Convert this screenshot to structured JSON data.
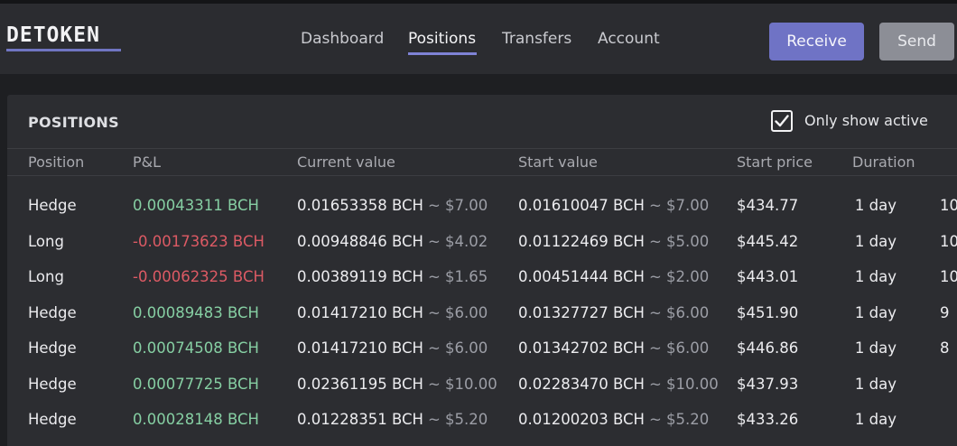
{
  "app": {
    "logo": "DETOKEN"
  },
  "nav": {
    "items": [
      {
        "label": "Dashboard",
        "active": false
      },
      {
        "label": "Positions",
        "active": true
      },
      {
        "label": "Transfers",
        "active": false
      },
      {
        "label": "Account",
        "active": false
      }
    ]
  },
  "actions": {
    "receive_label": "Receive",
    "send_label": "Send"
  },
  "colors": {
    "accent": "#6f73c5",
    "positive": "#86cfa3",
    "negative": "#dc5a64",
    "background": "#1e1f22",
    "panel": "#2c2d31"
  },
  "panel": {
    "title": "POSITIONS",
    "only_active": {
      "label": "Only show active",
      "checked": true
    },
    "columns": [
      "Position",
      "P&L",
      "Current value",
      "Start value",
      "Start price",
      "Duration"
    ],
    "rows": [
      {
        "position": "Hedge",
        "pnl": "0.00043311 BCH",
        "pnl_sign": "pos",
        "current_bch": "0.01653358 BCH",
        "current_usd": "~ $7.00",
        "start_bch": "0.01610047 BCH",
        "start_usd": "~ $7.00",
        "start_price": "$434.77",
        "duration": "1 day",
        "extra": "10"
      },
      {
        "position": "Long",
        "pnl": "-0.00173623 BCH",
        "pnl_sign": "neg",
        "current_bch": "0.00948846 BCH",
        "current_usd": "~ $4.02",
        "start_bch": "0.01122469 BCH",
        "start_usd": "~ $5.00",
        "start_price": "$445.42",
        "duration": "1 day",
        "extra": "10"
      },
      {
        "position": "Long",
        "pnl": "-0.00062325 BCH",
        "pnl_sign": "neg",
        "current_bch": "0.00389119 BCH",
        "current_usd": "~ $1.65",
        "start_bch": "0.00451444 BCH",
        "start_usd": "~ $2.00",
        "start_price": "$443.01",
        "duration": "1 day",
        "extra": "10"
      },
      {
        "position": "Hedge",
        "pnl": "0.00089483 BCH",
        "pnl_sign": "pos",
        "current_bch": "0.01417210 BCH",
        "current_usd": "~ $6.00",
        "start_bch": "0.01327727 BCH",
        "start_usd": "~ $6.00",
        "start_price": "$451.90",
        "duration": "1 day",
        "extra": "9"
      },
      {
        "position": "Hedge",
        "pnl": "0.00074508 BCH",
        "pnl_sign": "pos",
        "current_bch": "0.01417210 BCH",
        "current_usd": "~ $6.00",
        "start_bch": "0.01342702 BCH",
        "start_usd": "~ $6.00",
        "start_price": "$446.86",
        "duration": "1 day",
        "extra": "8"
      },
      {
        "position": "Hedge",
        "pnl": "0.00077725 BCH",
        "pnl_sign": "pos",
        "current_bch": "0.02361195 BCH",
        "current_usd": "~ $10.00",
        "start_bch": "0.02283470 BCH",
        "start_usd": "~ $10.00",
        "start_price": "$437.93",
        "duration": "1 day",
        "extra": ""
      },
      {
        "position": "Hedge",
        "pnl": "0.00028148 BCH",
        "pnl_sign": "pos",
        "current_bch": "0.01228351 BCH",
        "current_usd": "~ $5.20",
        "start_bch": "0.01200203 BCH",
        "start_usd": "~ $5.20",
        "start_price": "$433.26",
        "duration": "1 day",
        "extra": ""
      }
    ]
  }
}
